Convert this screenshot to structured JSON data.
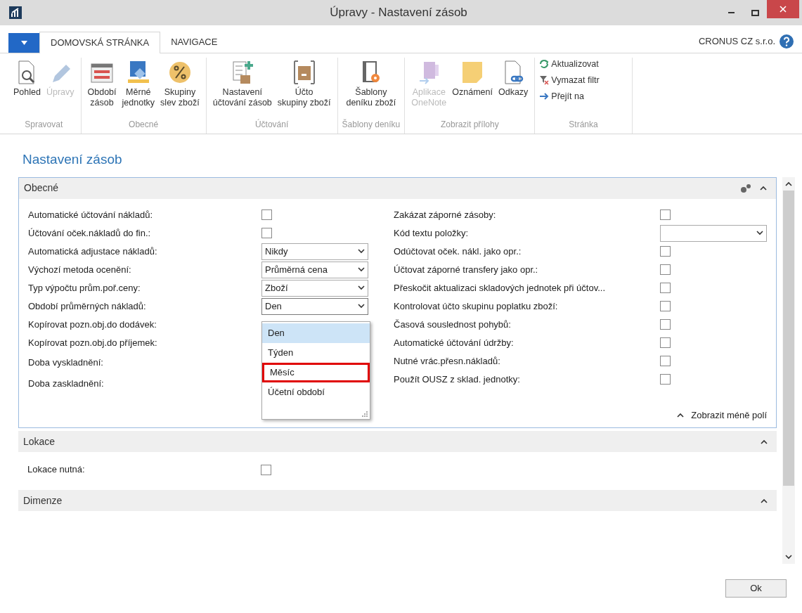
{
  "window": {
    "title": "Úpravy - Nastavení zásob"
  },
  "menu_tabs": [
    {
      "label": "DOMOVSKÁ STRÁNKA",
      "selected": true
    },
    {
      "label": "NAVIGACE",
      "selected": false
    }
  ],
  "company": "CRONUS CZ s.r.o.",
  "ribbon_groups": [
    {
      "label": "Spravovat",
      "buttons": [
        {
          "lines": [
            "Pohled"
          ],
          "disabled": false
        },
        {
          "lines": [
            "Úpravy"
          ],
          "disabled": true
        }
      ]
    },
    {
      "label": "Obecné",
      "buttons": [
        {
          "lines": [
            "Období",
            "zásob"
          ],
          "disabled": false
        },
        {
          "lines": [
            "Měrné",
            "jednotky"
          ],
          "disabled": false
        },
        {
          "lines": [
            "Skupiny",
            "slev zboží"
          ],
          "disabled": false
        }
      ]
    },
    {
      "label": "Účtování",
      "buttons": [
        {
          "lines": [
            "Nastavení",
            "účtování zásob"
          ],
          "disabled": false
        },
        {
          "lines": [
            "Účto",
            "skupiny zboží"
          ],
          "disabled": false
        }
      ]
    },
    {
      "label": "Šablony deníku",
      "buttons": [
        {
          "lines": [
            "Šablony",
            "deníku zboží"
          ],
          "disabled": false
        }
      ]
    },
    {
      "label": "Zobrazit přílohy",
      "buttons": [
        {
          "lines": [
            "Aplikace",
            "OneNote"
          ],
          "disabled": true
        },
        {
          "lines": [
            "Oznámení"
          ],
          "disabled": false
        },
        {
          "lines": [
            "Odkazy"
          ],
          "disabled": false
        }
      ]
    },
    {
      "label": "Stránka",
      "small_buttons": [
        "Aktualizovat",
        "Vymazat filtr",
        "Přejít na"
      ]
    }
  ],
  "page_title": "Nastavení zásob",
  "sections": [
    {
      "title": "Obecné",
      "expanded": true,
      "left_fields": [
        {
          "label": "Automatické účtování nákladů:",
          "kind": "checkbox",
          "checked": false
        },
        {
          "label": "Účtování oček.nákladů do fin.:",
          "kind": "checkbox",
          "checked": false
        },
        {
          "label": "Automatická adjustace nákladů:",
          "kind": "dropdown",
          "value": "Nikdy"
        },
        {
          "label": "Výchozí metoda ocenění:",
          "kind": "dropdown",
          "value": "Průměrná cena"
        },
        {
          "label": "Typ výpočtu prům.poř.ceny:",
          "kind": "dropdown",
          "value": "Zboží"
        },
        {
          "label": "Období průměrných nákladů:",
          "kind": "dropdown",
          "value": "Den",
          "open": true
        },
        {
          "label": "Kopírovat pozn.obj.do dodávek:",
          "kind": "covered"
        },
        {
          "label": "Kopírovat pozn.obj.do příjemek:",
          "kind": "covered"
        },
        {
          "label": "Doba vyskladnění:",
          "kind": "covered"
        },
        {
          "label": "Doba zaskladnění:",
          "kind": "covered"
        }
      ],
      "dropdown_options": [
        {
          "label": "Den",
          "selected": true,
          "outlined": false
        },
        {
          "label": "Týden",
          "selected": false,
          "outlined": false
        },
        {
          "label": "Měsíc",
          "selected": false,
          "outlined": true
        },
        {
          "label": "Účetní období",
          "selected": false,
          "outlined": false
        }
      ],
      "right_fields": [
        {
          "label": "Zakázat záporné zásoby:",
          "kind": "checkbox",
          "checked": false
        },
        {
          "label": "Kód textu položky:",
          "kind": "dropdown"
        },
        {
          "label": "Odúčtovat oček. nákl. jako opr.:",
          "kind": "checkbox",
          "checked": false
        },
        {
          "label": "Účtovat záporné transfery jako opr.:",
          "kind": "checkbox",
          "checked": false
        },
        {
          "label": "Přeskočit aktualizaci skladových jednotek při účtov...",
          "kind": "checkbox",
          "checked": false
        },
        {
          "label": "Kontrolovat účto skupinu poplatku zboží:",
          "kind": "checkbox",
          "checked": false
        },
        {
          "label": "Časová souslednost pohybů:",
          "kind": "checkbox",
          "checked": false
        },
        {
          "label": "Automatické účtování údržby:",
          "kind": "checkbox",
          "checked": false
        },
        {
          "label": "Nutné vrác.přesn.nákladů:",
          "kind": "checkbox",
          "checked": false
        },
        {
          "label": "Použít OUSZ z sklad. jednotky:",
          "kind": "checkbox",
          "checked": false
        }
      ],
      "footer_link": "Zobrazit méně polí"
    },
    {
      "title": "Lokace",
      "expanded": true,
      "left_fields": [
        {
          "label": "Lokace nutná:",
          "kind": "checkbox",
          "checked": false
        }
      ]
    },
    {
      "title": "Dimenze",
      "expanded": true
    }
  ],
  "ok_button": "Ok"
}
